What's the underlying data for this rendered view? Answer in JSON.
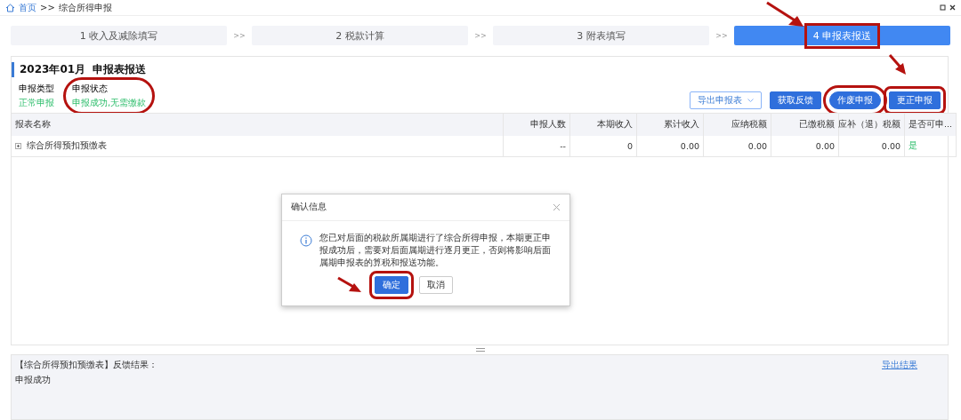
{
  "breadcrumb": {
    "home": "首页",
    "separator": ">>",
    "current": "综合所得申报"
  },
  "steps": [
    {
      "label": "1 收入及减除填写",
      "selected": false
    },
    {
      "label": "2 税款计算",
      "selected": false
    },
    {
      "label": "3 附表填写",
      "selected": false
    },
    {
      "label": "4 申报表报送",
      "selected": true,
      "boxed": true
    }
  ],
  "step_separator": ">>",
  "section": {
    "title": "2023年01月  申报表报送",
    "fields": [
      {
        "label": "申报类型",
        "value": "正常申报"
      },
      {
        "label": "申报状态",
        "value": "申报成功,无需缴款",
        "circled": true
      }
    ]
  },
  "actions": [
    {
      "label": "导出申报表",
      "kind": "dropdown"
    },
    {
      "label": "获取反馈",
      "kind": "primary"
    },
    {
      "label": "作废申报",
      "kind": "primary",
      "circled": true
    },
    {
      "label": "更正申报",
      "kind": "primary",
      "boxed": true
    }
  ],
  "table": {
    "columns": [
      "报表名称",
      "申报人数",
      "本期收入",
      "累计收入",
      "应纳税额",
      "已缴税额",
      "应补（退）税额",
      "是否可申..."
    ],
    "rows": [
      {
        "cells": [
          "综合所得预扣预缴表",
          "--",
          "0",
          "0.00",
          "0.00",
          "0.00",
          "0.00",
          "是"
        ]
      }
    ]
  },
  "dialog": {
    "title": "确认信息",
    "message": "您已对后面的税款所属期进行了综合所得申报，本期更正申报成功后，需要对后面属期进行逐月更正，否则将影响后面属期申报表的算税和报送功能。",
    "buttons": [
      {
        "label": "确定",
        "kind": "primary",
        "boxed": true
      },
      {
        "label": "取消",
        "kind": "default"
      }
    ]
  },
  "feedback": {
    "title": "【综合所得预扣预缴表】反馈结果：",
    "text": "申报成功",
    "link": "导出结果"
  }
}
